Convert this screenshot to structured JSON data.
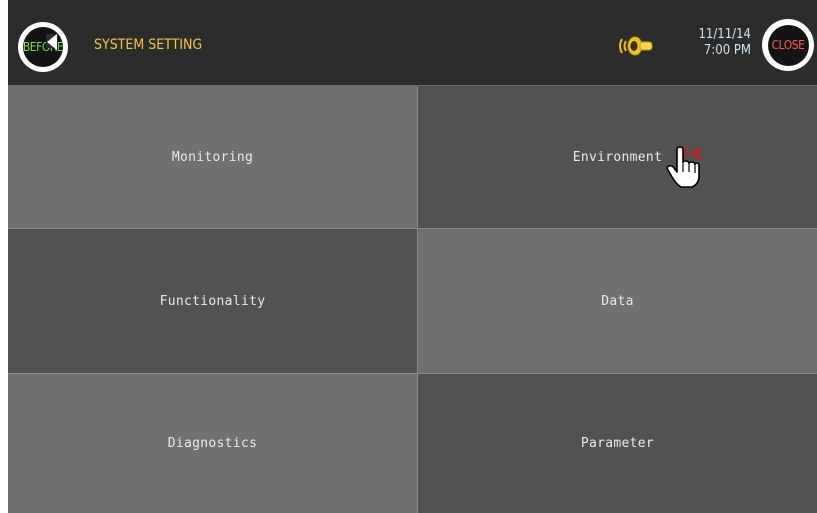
{
  "header": {
    "before_label": "BEFORE",
    "title": "SYSTEM SETTING",
    "date": "11/11/14",
    "time": "7:00 PM",
    "close_label": "CLOSE",
    "alarm_icon": "alarm-bell-icon",
    "title_color": "#f2c54a",
    "before_color": "#7ed957",
    "close_color": "#ff5a4a"
  },
  "tiles": [
    {
      "label": "Monitoring"
    },
    {
      "label": "Environment"
    },
    {
      "label": "Functionality"
    },
    {
      "label": "Data"
    },
    {
      "label": "Diagnostics"
    },
    {
      "label": "Parameter"
    }
  ],
  "cursor": {
    "icon": "hand-pointer-icon"
  }
}
